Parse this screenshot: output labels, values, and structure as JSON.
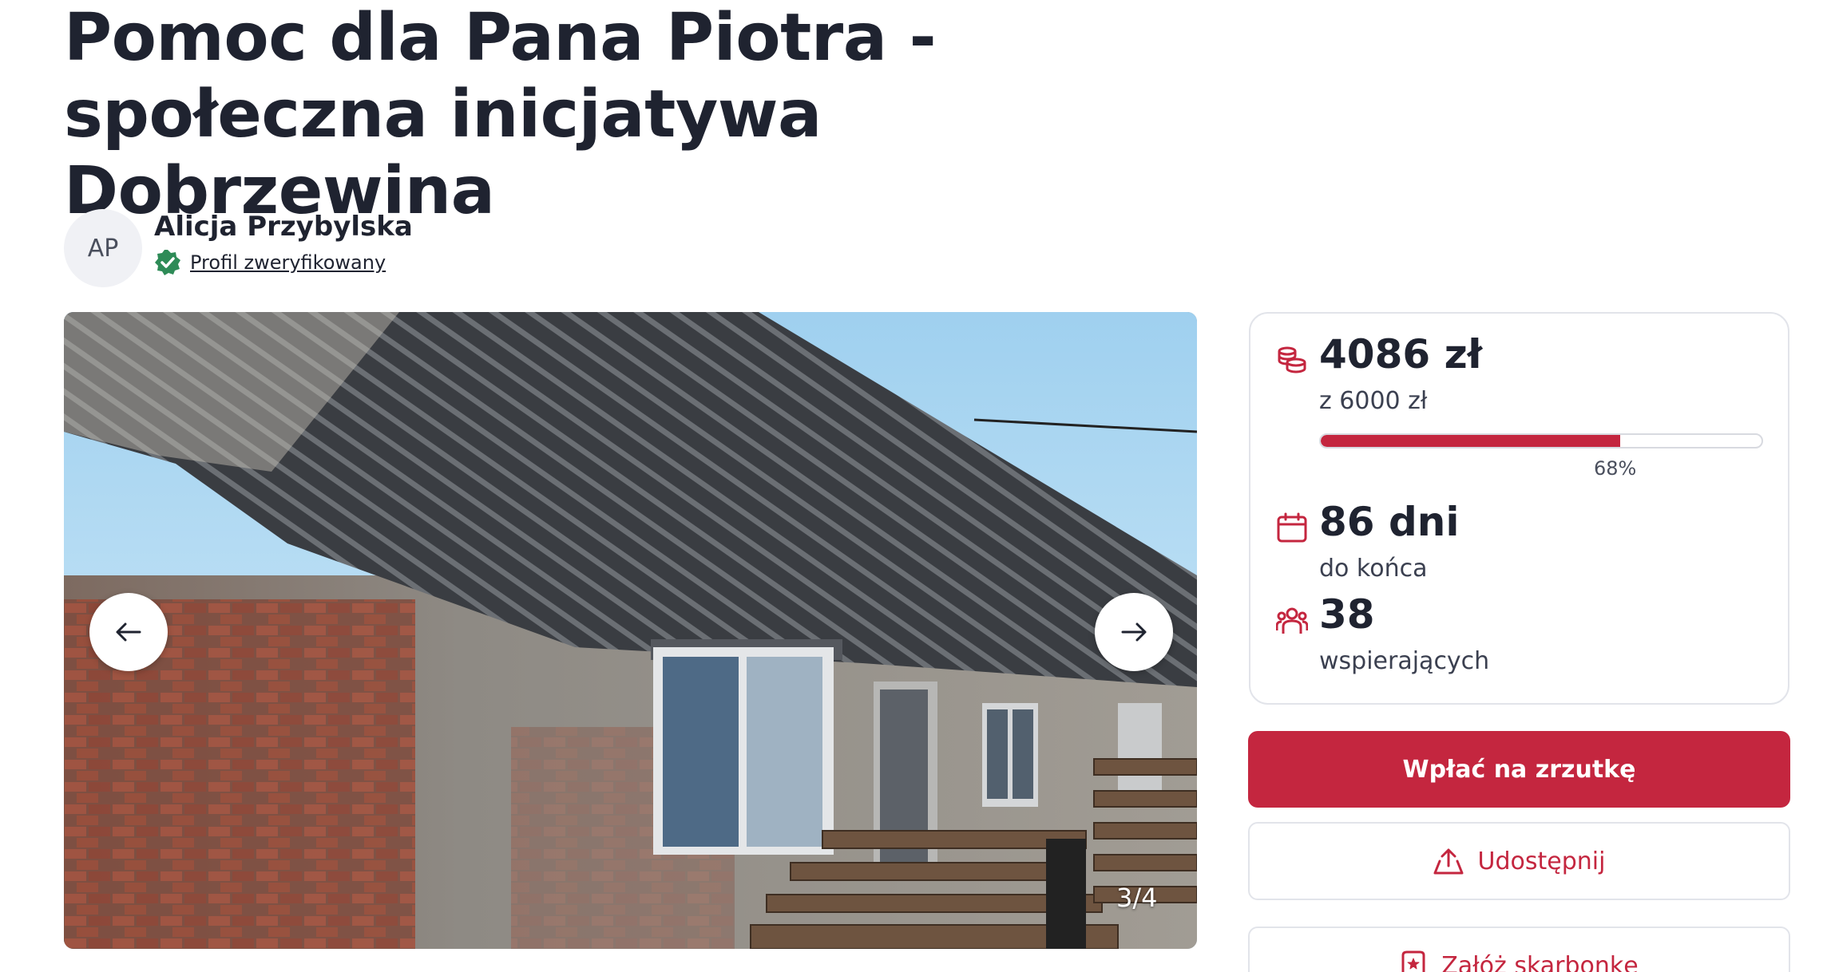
{
  "page": {
    "title": "Pomoc dla Pana Piotra - społeczna inicjatywa Dobrzewina"
  },
  "author": {
    "initials": "AP",
    "name": "Alicja Przybylska",
    "verified_label": "Profil zweryfikowany"
  },
  "gallery": {
    "counter": "3/4",
    "icons": {
      "prev": "arrow-left-icon",
      "next": "arrow-right-icon"
    }
  },
  "stats": {
    "raised": "4086 zł",
    "goal": "z 6000 zł",
    "progress_fraction": 0.68,
    "progress_label": "68%",
    "days": "86 dni",
    "days_label": "do końca",
    "supporters": "38",
    "supporters_label": "wspierających",
    "icons": {
      "money": "coins-stack-icon",
      "days": "calendar-icon",
      "supporters": "people-group-icon"
    }
  },
  "actions": {
    "donate": "Wpłać na zrzutkę",
    "share": "Udostępnij",
    "piggy": "Załóż skarbonkę"
  },
  "colors": {
    "accent": "#c4263f",
    "verified": "#2e8b57",
    "text": "#1f2330"
  }
}
